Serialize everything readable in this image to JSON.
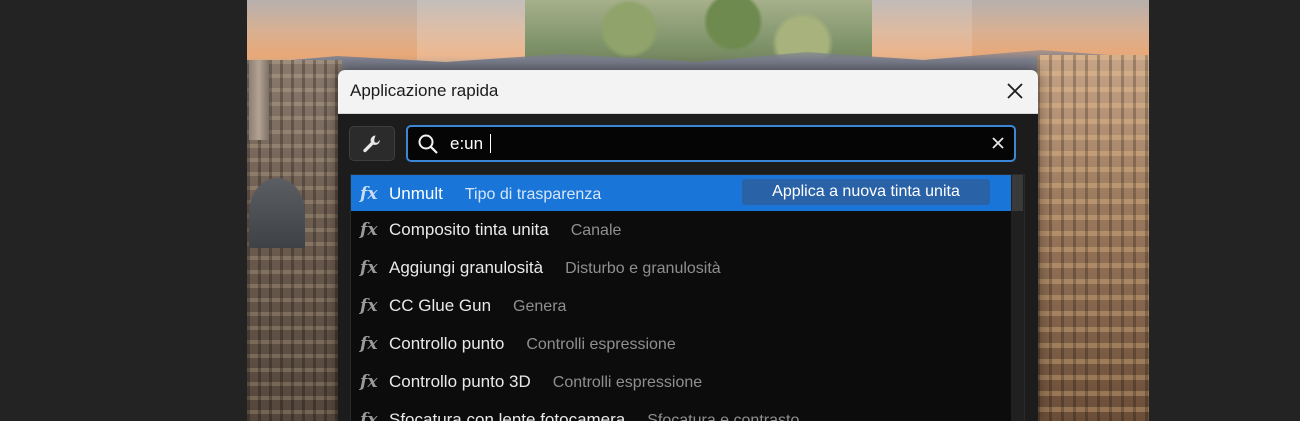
{
  "dialog": {
    "title": "Applicazione rapida"
  },
  "search": {
    "value": "e:un"
  },
  "icons": {
    "close": "close-icon",
    "tools": "wrench-icon",
    "search": "search-icon",
    "clear": "clear-icon",
    "effect": "fx-icon"
  },
  "colors": {
    "accent": "#1976d8",
    "search_border": "#3c86d6",
    "apply_button": "#2a62a8"
  },
  "results": [
    {
      "icon": "fx",
      "name": "Unmult",
      "category": "Tipo di trasparenza",
      "selected": true,
      "action": "Applica a nuova tinta unita"
    },
    {
      "icon": "fx",
      "name": "Composito tinta unita",
      "category": "Canale"
    },
    {
      "icon": "fx",
      "name": "Aggiungi granulosità",
      "category": "Disturbo e granulosità"
    },
    {
      "icon": "fx",
      "name": "CC Glue Gun",
      "category": "Genera"
    },
    {
      "icon": "fx",
      "name": "Controllo punto",
      "category": "Controlli espressione"
    },
    {
      "icon": "fx",
      "name": "Controllo punto 3D",
      "category": "Controlli espressione"
    },
    {
      "icon": "fx",
      "name": "Sfocatura con lente fotocamera",
      "category": "Sfocatura e contrasto"
    }
  ]
}
